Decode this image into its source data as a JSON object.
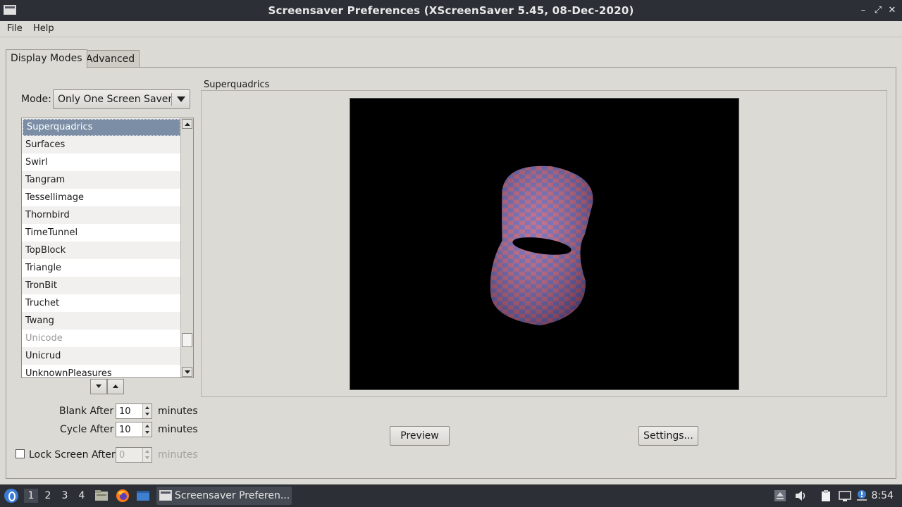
{
  "window": {
    "title": "Screensaver Preferences  (XScreenSaver 5.45, 08-Dec-2020)",
    "controls": {
      "minimize": "–",
      "maximize": "⤢",
      "close": "✕"
    }
  },
  "menu": {
    "file": "File",
    "help": "Help"
  },
  "tabs": {
    "display_modes": "Display Modes",
    "advanced": "Advanced"
  },
  "mode": {
    "label": "Mode:",
    "value": "Only One Screen Saver"
  },
  "saver_list": [
    "Superquadrics",
    "Surfaces",
    "Swirl",
    "Tangram",
    "Tessellimage",
    "Thornbird",
    "TimeTunnel",
    "TopBlock",
    "Triangle",
    "TronBit",
    "Truchet",
    "Twang",
    "Unicode",
    "Unicrud",
    "UnknownPleasures"
  ],
  "selected_saver": "Superquadrics",
  "disabled_saver": "Unicode",
  "blank_after": {
    "label": "Blank After",
    "value": "10",
    "unit": "minutes"
  },
  "cycle_after": {
    "label": "Cycle After",
    "value": "10",
    "unit": "minutes"
  },
  "lock_screen": {
    "label": "Lock Screen After",
    "value": "0",
    "unit": "minutes",
    "checked": false
  },
  "preview_frame": {
    "title": "Superquadrics"
  },
  "buttons": {
    "preview": "Preview",
    "settings": "Settings..."
  },
  "taskbar": {
    "workspaces": [
      "1",
      "2",
      "3",
      "4"
    ],
    "active_workspace": "1",
    "task_label": "Screensaver Preferen...",
    "clock": "8:54"
  },
  "colors": {
    "selection": "#7c8ea6",
    "titlebar": "#2c2f35",
    "stripe_a": "#c05a78",
    "stripe_b": "#6a5fb0"
  }
}
